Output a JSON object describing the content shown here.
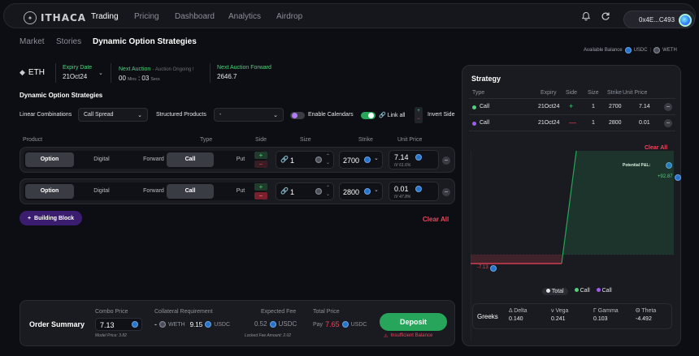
{
  "nav": {
    "brand": "ITHACA",
    "items": [
      "Trading",
      "Pricing",
      "Dashboard",
      "Analytics",
      "Airdrop"
    ],
    "active": "Trading",
    "wallet": "0x4E...C493"
  },
  "breadcrumb": [
    "Market",
    "Stories",
    "Dynamic Option Strategies"
  ],
  "balance": {
    "label": "Available Balance",
    "usdc": "USDC",
    "weth": "WETH"
  },
  "market": {
    "asset": "ETH",
    "expiry_label": "Expiry Date",
    "expiry_value": "21Oct24",
    "auction_label": "Next Auction",
    "auction_status": "- Auction Ongoing !",
    "auction_min": "00",
    "auction_min_unit": "Mins",
    "auction_sec": "03",
    "auction_sec_unit": "Secs",
    "forward_label": "Next Auction Forward",
    "forward_value": "2646.7"
  },
  "section_title": "Dynamic Option Strategies",
  "controls": {
    "linear_label": "Linear Combinations",
    "linear_value": "Call Spread",
    "structured_label": "Structured Products",
    "structured_value": "-",
    "enable_calendars": "Enable Calendars",
    "link_all": "Link all",
    "invert_side": "Invert Side"
  },
  "table_headers": {
    "product": "Product",
    "type": "Type",
    "side": "Side",
    "size": "Size",
    "strike": "Strike",
    "unit_price": "Unit Price"
  },
  "product_tabs": [
    "Option",
    "Digital",
    "Forward"
  ],
  "type_tabs": [
    "Call",
    "Put"
  ],
  "legs": [
    {
      "size": "1",
      "strike": "2700",
      "price": "7.14",
      "iv": "IV 61.6%",
      "side": "buy"
    },
    {
      "size": "1",
      "strike": "2800",
      "price": "0.01",
      "iv": "IV 47.8%",
      "side": "sell"
    }
  ],
  "build_button": "Building Block",
  "clear_all": "Clear All",
  "order": {
    "title": "Order Summary",
    "combo_label": "Combo Price",
    "combo_value": "7.13",
    "model_price": "Model Price: 3.82",
    "collateral_label": "Collateral Requirement",
    "collateral_weth": "-",
    "collateral_weth_unit": "WETH",
    "collateral_usdc": "9.15",
    "collateral_usdc_unit": "USDC",
    "fee_label": "Expected Fee",
    "fee_value": "0.52",
    "fee_unit": "USDC",
    "locked_fee": "Locked Fee Amount: 2.02",
    "total_label": "Total Price",
    "total_prefix": "Pay",
    "total_value": "7.65",
    "total_unit": "USDC",
    "deposit": "Deposit",
    "warning": "Insufficient Balance"
  },
  "strategy": {
    "title": "Strategy",
    "headers": [
      "Type",
      "Expiry",
      "Side",
      "Size",
      "Strike",
      "Unit Price"
    ],
    "rows": [
      {
        "type": "Call",
        "expiry": "21Oct24",
        "side": "+",
        "size": "1",
        "strike": "2700",
        "price": "7.14",
        "color": "#4fd07a"
      },
      {
        "type": "Call",
        "expiry": "21Oct24",
        "side": "—",
        "size": "1",
        "strike": "2800",
        "price": "0.01",
        "color": "#a15bf0"
      }
    ],
    "clear_all": "Clear All",
    "pnl_label": "Potential P&L:",
    "legend": [
      "Total",
      "Call",
      "Call"
    ]
  },
  "chart_data": {
    "type": "line",
    "series": [
      {
        "values": [
          -7.13,
          -7.13,
          92.87,
          92.87
        ]
      }
    ],
    "annotations": [
      "-7.13",
      "+92.87"
    ]
  },
  "greeks": {
    "title": "Greeks",
    "items": [
      {
        "label": "Δ Delta",
        "value": "0.140"
      },
      {
        "label": "ν Vega",
        "value": "0.241"
      },
      {
        "label": "Γ Gamma",
        "value": "0.103"
      },
      {
        "label": "Θ Theta",
        "value": "-4.492"
      }
    ]
  },
  "colors": {
    "accent_green": "#27a55a",
    "accent_red": "#f0445a",
    "accent_purple": "#3a1d6e"
  }
}
